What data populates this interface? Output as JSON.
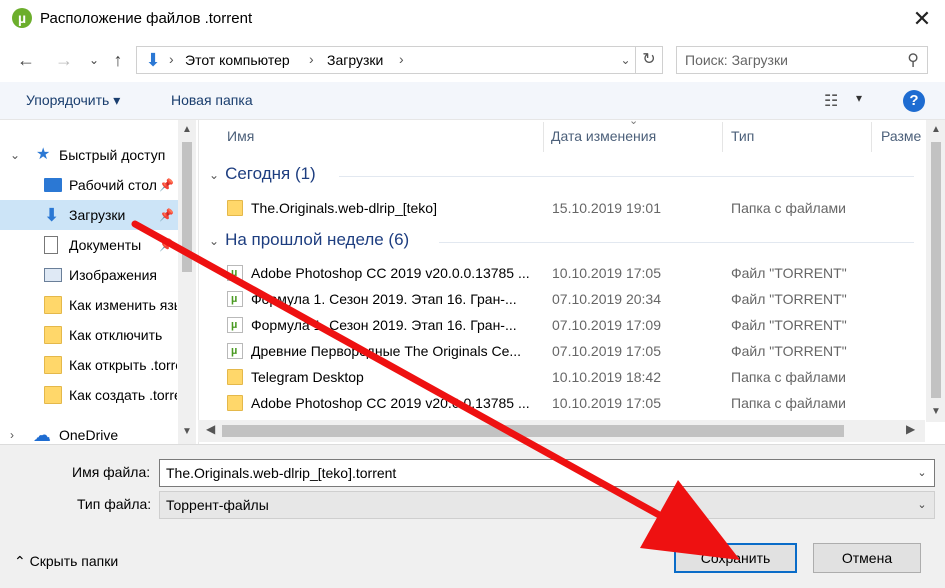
{
  "window": {
    "title": "Расположение файлов .torrent",
    "app_icon": "utorrent-icon",
    "close_glyph": "✕"
  },
  "nav": {
    "back_glyph": "←",
    "forward_glyph": "→",
    "recent_glyph": "⌄",
    "up_glyph": "↑"
  },
  "address": {
    "crumbs": [
      "Этот компьютер",
      "Загрузки"
    ],
    "sep": "›",
    "refresh_glyph": "↻"
  },
  "search": {
    "placeholder": "Поиск: Загрузки",
    "icon_glyph": "⚲"
  },
  "toolbar": {
    "organize_label": "Упорядочить ▾",
    "new_folder_label": "Новая папка",
    "view_glyph": "☷",
    "view_dd_glyph": "▾",
    "help_glyph": "?"
  },
  "sidebar": {
    "items": [
      {
        "label": "Быстрый доступ",
        "icon": "star-icon",
        "color": "#2b78d4"
      },
      {
        "label": "Рабочий стол",
        "icon": "desktop-icon",
        "color": "#2b78d4"
      },
      {
        "label": "Загрузки",
        "icon": "download-icon",
        "color": "#2b78d4"
      },
      {
        "label": "Документы",
        "icon": "document-icon",
        "color": "#555555"
      },
      {
        "label": "Изображения",
        "icon": "pictures-icon",
        "color": "#555555"
      },
      {
        "label": "Как изменить язык",
        "icon": "folder-icon",
        "color": "#ffd76a"
      },
      {
        "label": "Как отключить",
        "icon": "folder-icon",
        "color": "#ffd76a"
      },
      {
        "label": "Как открыть .torrent",
        "icon": "folder-icon",
        "color": "#ffd76a"
      },
      {
        "label": "Как создать .torrent",
        "icon": "folder-icon",
        "color": "#ffd76a"
      },
      {
        "label": "OneDrive",
        "icon": "cloud-icon",
        "color": "#1e6cd1"
      }
    ]
  },
  "columns": {
    "name": "Имя",
    "date": "Дата изменения",
    "type": "Тип",
    "size": "Разме"
  },
  "groups": [
    {
      "title": "Сегодня (1)",
      "rows": [
        {
          "name": "The.Originals.web-dlrip_[teko]",
          "date": "15.10.2019 19:01",
          "type": "Папка с файлами",
          "kind": "folder"
        }
      ]
    },
    {
      "title": "На прошлой неделе (6)",
      "rows": [
        {
          "name": "Adobe Photoshop CC 2019 v20.0.0.13785 ...",
          "date": "10.10.2019 17:05",
          "type": "Файл \"TORRENT\"",
          "kind": "torrent"
        },
        {
          "name": "Формула 1. Сезон 2019. Этап 16. Гран-...",
          "date": "07.10.2019 20:34",
          "type": "Файл \"TORRENT\"",
          "kind": "torrent"
        },
        {
          "name": "Формула 1. Сезон 2019. Этап 16. Гран-...",
          "date": "07.10.2019 17:09",
          "type": "Файл \"TORRENT\"",
          "kind": "torrent"
        },
        {
          "name": "Древние Первородные The Originals Се...",
          "date": "07.10.2019 17:05",
          "type": "Файл \"TORRENT\"",
          "kind": "torrent"
        },
        {
          "name": "Telegram Desktop",
          "date": "10.10.2019 18:42",
          "type": "Папка с файлами",
          "kind": "folder"
        },
        {
          "name": "Adobe Photoshop CC 2019 v20.0.0.13785 ...",
          "date": "10.10.2019 17:05",
          "type": "Папка с файлами",
          "kind": "folder"
        }
      ]
    }
  ],
  "form": {
    "filename_label": "Имя файла:",
    "filename_value": "The.Originals.web-dlrip_[teko].torrent",
    "filetype_label": "Тип файла:",
    "filetype_value": "Торрент-файлы"
  },
  "footer": {
    "hide_folders_label": "⌃  Скрыть папки",
    "save_label": "Сохранить",
    "cancel_label": "Отмена"
  },
  "colors": {
    "accent": "#0a6cc8",
    "selected_bg": "#cce4f7",
    "arrow": "#ee1111"
  }
}
